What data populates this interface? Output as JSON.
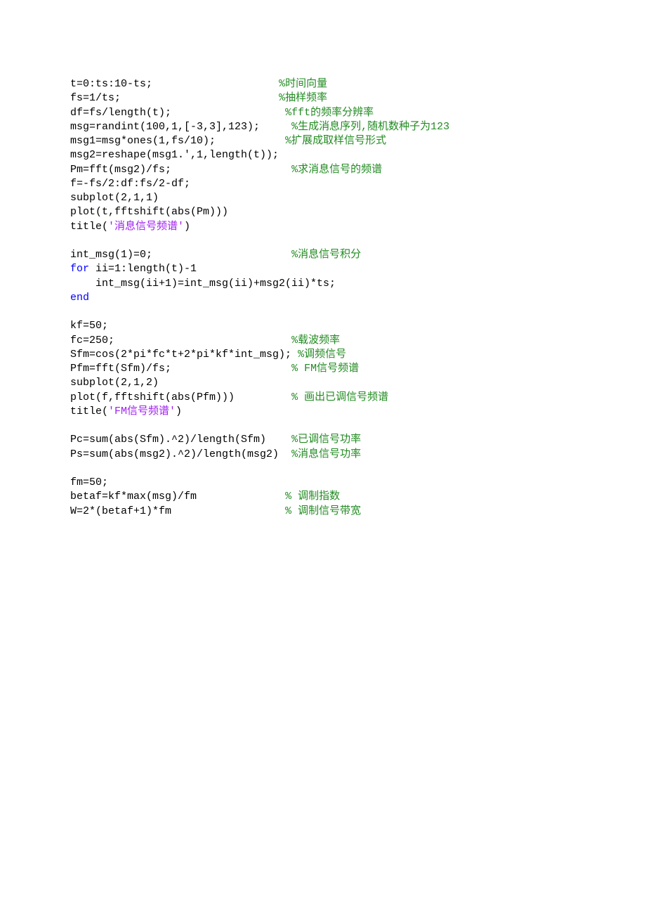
{
  "lines": [
    {
      "segments": [
        {
          "t": "t=0:ts:10-ts;                    ",
          "cls": "plain"
        },
        {
          "t": "%时间向量",
          "cls": "c"
        }
      ]
    },
    {
      "segments": [
        {
          "t": "fs=1/ts;                         ",
          "cls": "plain"
        },
        {
          "t": "%抽样频率",
          "cls": "c"
        }
      ]
    },
    {
      "segments": [
        {
          "t": "df=fs/length(t);                  ",
          "cls": "plain"
        },
        {
          "t": "%fft的频率分辨率",
          "cls": "c"
        }
      ]
    },
    {
      "segments": [
        {
          "t": "msg=randint(100,1,[-3,3],123);     ",
          "cls": "plain"
        },
        {
          "t": "%生成消息序列,随机数种子为123",
          "cls": "c"
        }
      ]
    },
    {
      "segments": [
        {
          "t": "msg1=msg*ones(1,fs/10);           ",
          "cls": "plain"
        },
        {
          "t": "%扩展成取样信号形式",
          "cls": "c"
        }
      ]
    },
    {
      "segments": [
        {
          "t": "msg2=reshape(msg1.',1,length(t));",
          "cls": "plain"
        }
      ]
    },
    {
      "segments": [
        {
          "t": "Pm=fft(msg2)/fs;                   ",
          "cls": "plain"
        },
        {
          "t": "%求消息信号的频谱",
          "cls": "c"
        }
      ]
    },
    {
      "segments": [
        {
          "t": "f=-fs/2:df:fs/2-df;",
          "cls": "plain"
        }
      ]
    },
    {
      "segments": [
        {
          "t": "subplot(2,1,1)",
          "cls": "plain"
        }
      ]
    },
    {
      "segments": [
        {
          "t": "plot(t,fftshift(abs(Pm)))",
          "cls": "plain"
        }
      ]
    },
    {
      "segments": [
        {
          "t": "title(",
          "cls": "plain"
        },
        {
          "t": "'消息信号频谱'",
          "cls": "s"
        },
        {
          "t": ")",
          "cls": "plain"
        }
      ]
    },
    {
      "segments": [
        {
          "t": "",
          "cls": "plain"
        }
      ]
    },
    {
      "segments": [
        {
          "t": "int_msg(1)=0;                      ",
          "cls": "plain"
        },
        {
          "t": "%消息信号积分",
          "cls": "c"
        }
      ]
    },
    {
      "segments": [
        {
          "t": "for ",
          "cls": "k"
        },
        {
          "t": "ii=1:length(t)-1",
          "cls": "plain"
        }
      ]
    },
    {
      "segments": [
        {
          "t": "    int_msg(ii+1)=int_msg(ii)+msg2(ii)*ts;",
          "cls": "plain"
        }
      ]
    },
    {
      "segments": [
        {
          "t": "end",
          "cls": "k"
        }
      ]
    },
    {
      "segments": [
        {
          "t": "",
          "cls": "plain"
        }
      ]
    },
    {
      "segments": [
        {
          "t": "kf=50;",
          "cls": "plain"
        }
      ]
    },
    {
      "segments": [
        {
          "t": "fc=250;                            ",
          "cls": "plain"
        },
        {
          "t": "%载波频率",
          "cls": "c"
        }
      ]
    },
    {
      "segments": [
        {
          "t": "Sfm=cos(2*pi*fc*t+2*pi*kf*int_msg); ",
          "cls": "plain"
        },
        {
          "t": "%调频信号",
          "cls": "c"
        }
      ]
    },
    {
      "segments": [
        {
          "t": "Pfm=fft(Sfm)/fs;                   ",
          "cls": "plain"
        },
        {
          "t": "% FM信号频谱",
          "cls": "c"
        }
      ]
    },
    {
      "segments": [
        {
          "t": "subplot(2,1,2)",
          "cls": "plain"
        }
      ]
    },
    {
      "segments": [
        {
          "t": "plot(f,fftshift(abs(Pfm)))         ",
          "cls": "plain"
        },
        {
          "t": "% 画出已调信号频谱",
          "cls": "c"
        }
      ]
    },
    {
      "segments": [
        {
          "t": "title(",
          "cls": "plain"
        },
        {
          "t": "'FM信号频谱'",
          "cls": "s"
        },
        {
          "t": ")",
          "cls": "plain"
        }
      ]
    },
    {
      "segments": [
        {
          "t": "",
          "cls": "plain"
        }
      ]
    },
    {
      "segments": [
        {
          "t": "Pc=sum(abs(Sfm).^2)/length(Sfm)    ",
          "cls": "plain"
        },
        {
          "t": "%已调信号功率",
          "cls": "c"
        }
      ]
    },
    {
      "segments": [
        {
          "t": "Ps=sum(abs(msg2).^2)/length(msg2)  ",
          "cls": "plain"
        },
        {
          "t": "%消息信号功率",
          "cls": "c"
        }
      ]
    },
    {
      "segments": [
        {
          "t": "",
          "cls": "plain"
        }
      ]
    },
    {
      "segments": [
        {
          "t": "fm=50;",
          "cls": "plain"
        }
      ]
    },
    {
      "segments": [
        {
          "t": "betaf=kf*max(msg)/fm              ",
          "cls": "plain"
        },
        {
          "t": "% 调制指数",
          "cls": "c"
        }
      ]
    },
    {
      "segments": [
        {
          "t": "W=2*(betaf+1)*fm                  ",
          "cls": "plain"
        },
        {
          "t": "% 调制信号带宽",
          "cls": "c"
        }
      ]
    }
  ]
}
